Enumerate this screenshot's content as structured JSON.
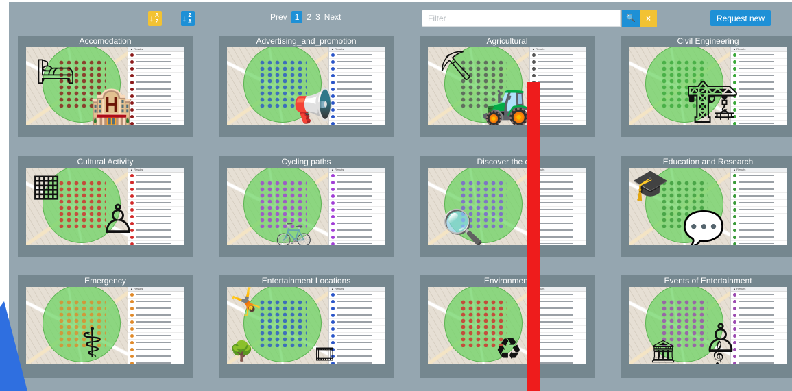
{
  "toolbar": {
    "sort_az": {
      "arrow": "↓",
      "top": "A",
      "bottom": "Z",
      "icon": "sort-alpha-asc-icon"
    },
    "sort_za": {
      "arrow": "↓",
      "top": "Z",
      "bottom": "A",
      "icon": "sort-alpha-desc-icon"
    },
    "pagination": {
      "prev": "Prev",
      "pages": [
        "1",
        "2",
        "3"
      ],
      "active_page": "1",
      "next": "Next"
    },
    "filter": {
      "placeholder": "Filter",
      "value": ""
    },
    "search_icon": "🔍",
    "clear_icon": "×",
    "request_new": "Request new"
  },
  "cards": [
    {
      "title": "Accomodation",
      "dot_color": "#8b1a1a",
      "icons": [
        "bed-icon",
        "hotel-icon"
      ]
    },
    {
      "title": "Advertising_and_promotion",
      "dot_color": "#2a55c8",
      "icons": [
        "megaphone-icon"
      ]
    },
    {
      "title": "Agricultural",
      "dot_color": "#555555",
      "icons": [
        "farmer-icon",
        "tractor-icon"
      ]
    },
    {
      "title": "Civil Engineering",
      "dot_color": "#3aa83a",
      "icons": [
        "building-crane-icon"
      ]
    },
    {
      "title": "Cultural Activity",
      "dot_color": "#d22a2a",
      "icons": [
        "gallery-icon",
        "statue-icon"
      ]
    },
    {
      "title": "Cycling paths",
      "dot_color": "#a13fd6",
      "icons": [
        "bicycle-icon"
      ]
    },
    {
      "title": "Discover the city",
      "dot_color": "#7b5cd6",
      "icons": [
        "magnifier-icon"
      ]
    },
    {
      "title": "Education and Research",
      "dot_color": "#3a9a3a",
      "icons": [
        "graduation-cap-icon",
        "speech-bubble-icon"
      ]
    },
    {
      "title": "Emergency",
      "dot_color": "#e08a2a",
      "icons": [
        "caduceus-icon"
      ]
    },
    {
      "title": "Entertainment Locations",
      "dot_color": "#2a55c8",
      "icons": [
        "dancer-icon",
        "trees-icon",
        "film-reel-icon"
      ]
    },
    {
      "title": "Environment",
      "dot_color": "#d22a2a",
      "icons": [
        "recycle-icon"
      ]
    },
    {
      "title": "Events of Entertainment",
      "dot_color": "#9b4bb0",
      "icons": [
        "statue-icon",
        "museum-icon",
        "music-icon"
      ]
    }
  ],
  "list_header": "▲ Results"
}
